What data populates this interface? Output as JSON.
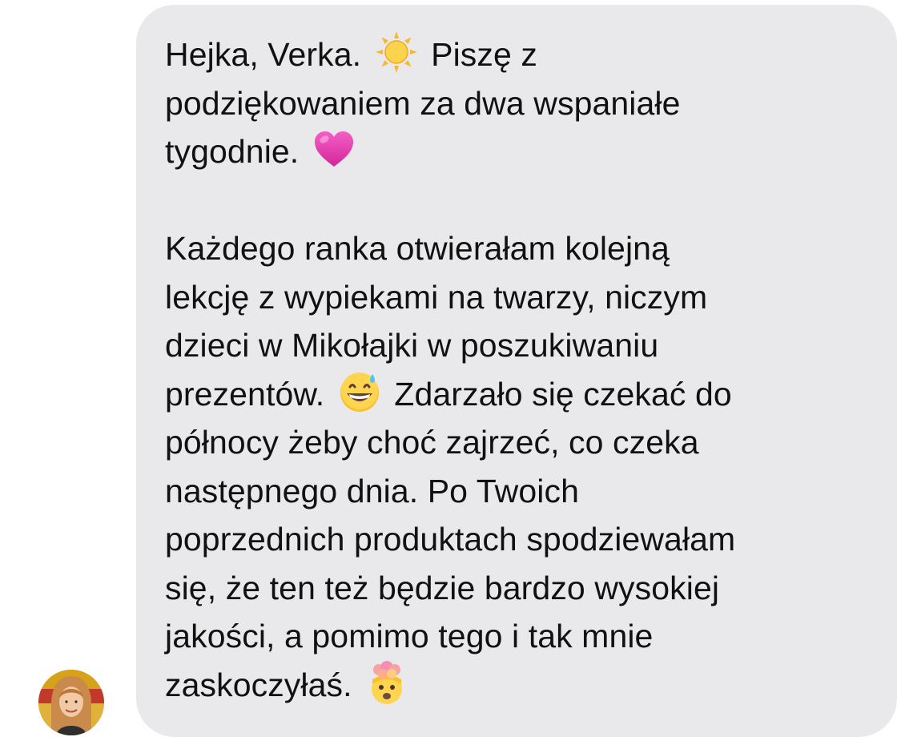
{
  "conversation": {
    "message": {
      "lines_p1": [
        "Hejka, Verka.",
        "Piszę z",
        "podziękowaniem za dwa wspaniałe",
        "tygodnie."
      ],
      "lines_p2": [
        "Każdego ranka otwierałam kolejną",
        "lekcję z wypiekami na twarzy, niczym",
        "dzieci w Mikołajki w poszukiwaniu",
        "prezentów.",
        "Zdarzało się czekać do",
        "północy żeby choć zajrzeć, co czeka",
        "następnego dnia. Po Twoich",
        "poprzednich produktach spodziewałam",
        "się, że ten też będzie bardzo wysokiej",
        "jakości, a pomimo tego i tak mnie",
        "zaskoczyłaś."
      ],
      "emojis": [
        "sun-emoji",
        "pink-heart-emoji",
        "grinning-sweat-emoji",
        "exploding-head-emoji"
      ]
    },
    "sender": {
      "avatar": "avatar"
    }
  }
}
